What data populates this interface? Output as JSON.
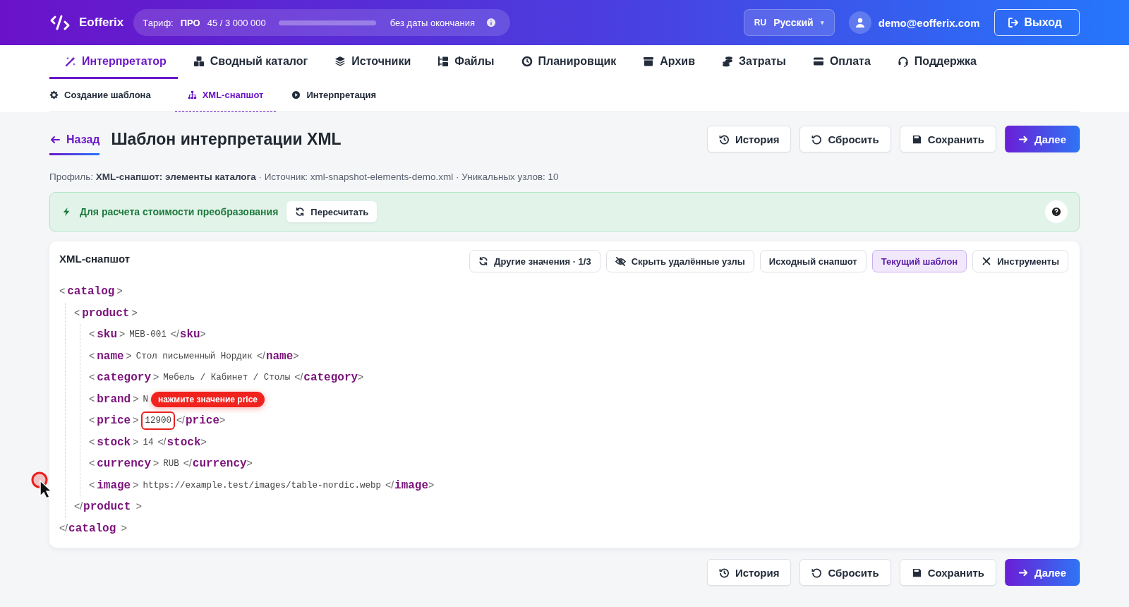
{
  "header": {
    "logo_text": "Eofferix",
    "plan": {
      "label": "Тариф:",
      "name": "ПРО",
      "usage": "45 / 3 000 000",
      "level": 2e-05,
      "expiry": "без даты окончания"
    },
    "language": {
      "code": "RU",
      "name": "Русский",
      "caret": "▾"
    },
    "user": {
      "email": "demo@eofferix.com"
    },
    "logout": "Выход"
  },
  "nav": {
    "tabs": [
      {
        "label": "Интерпретатор",
        "selected": true
      },
      {
        "label": "Сводный каталог",
        "selected": false
      },
      {
        "label": "Источники",
        "selected": false
      },
      {
        "label": "Файлы",
        "selected": false
      },
      {
        "label": "Планировщик",
        "selected": false
      },
      {
        "label": "Архив",
        "selected": false
      },
      {
        "label": "Затраты",
        "selected": false
      },
      {
        "label": "Оплата",
        "selected": false
      },
      {
        "label": "Поддержка",
        "selected": false
      }
    ],
    "subtabs": [
      {
        "label": "Создание шаблона",
        "selected": false
      },
      {
        "label": "XML-снапшот",
        "selected": true
      },
      {
        "label": "Интерпретация",
        "selected": false
      }
    ]
  },
  "page": {
    "back": "Назад",
    "title": "Шаблон интерпретации XML",
    "actions": [
      {
        "label": "История",
        "kind": "default"
      },
      {
        "label": "Сбросить",
        "kind": "default"
      },
      {
        "label": "Сохранить",
        "kind": "default"
      },
      {
        "label": "Далее",
        "kind": "primary"
      }
    ],
    "info": "Профиль: **XML-снапшот: элементы каталога** · Источник: xml-snapshot-elements-demo.xml · Уникальных узлов: 10",
    "alert": {
      "text": "Для расчета стоимости преобразования",
      "button": "Пересчитать"
    },
    "snapshot": {
      "title": "XML-снапшот",
      "toolbar": [
        {
          "label": "Другие значения · 1/3",
          "selected": false
        },
        {
          "label": "Скрыть удалённые узлы",
          "selected": false
        },
        {
          "label": "Исходный снапшот",
          "selected": false
        },
        {
          "label": "Текущий шаблон",
          "selected": true
        },
        {
          "label": "Инструменты",
          "selected": false
        }
      ],
      "syntax": {
        "open": "<",
        "end": ">",
        "close": "</"
      },
      "tree": {
        "tag": "catalog",
        "close_tag": "catalog",
        "children": [
          {
            "tag": "product",
            "close_tag": "product",
            "children": [
              {
                "tag": "sku",
                "value": "MEB-001",
                "close_tag": "sku",
                "highlighted": false
              },
              {
                "tag": "name",
                "value": "Стол письменный Нордик",
                "close_tag": "name",
                "highlighted": false
              },
              {
                "tag": "category",
                "value": "Мебель / Кабинет / Столы",
                "close_tag": "category",
                "highlighted": false
              },
              {
                "tag": "brand",
                "value": "N",
                "highlighted": false,
                "tooltip": "нажмите значение price"
              },
              {
                "tag": "price",
                "value": "12900",
                "close_tag": "price",
                "highlighted": true
              },
              {
                "tag": "stock",
                "value": "14",
                "close_tag": "stock",
                "highlighted": false
              },
              {
                "tag": "currency",
                "value": "RUB",
                "close_tag": "currency",
                "highlighted": false
              },
              {
                "tag": "image",
                "value": "https://example.test/images/table-nordic.webp",
                "close_tag": "image",
                "highlighted": false
              }
            ]
          }
        ]
      }
    },
    "bottom_actions": [
      {
        "label": "История",
        "kind": "default"
      },
      {
        "label": "Сбросить",
        "kind": "default"
      },
      {
        "label": "Сохранить",
        "kind": "default"
      },
      {
        "label": "Далее",
        "kind": "primary"
      }
    ]
  }
}
